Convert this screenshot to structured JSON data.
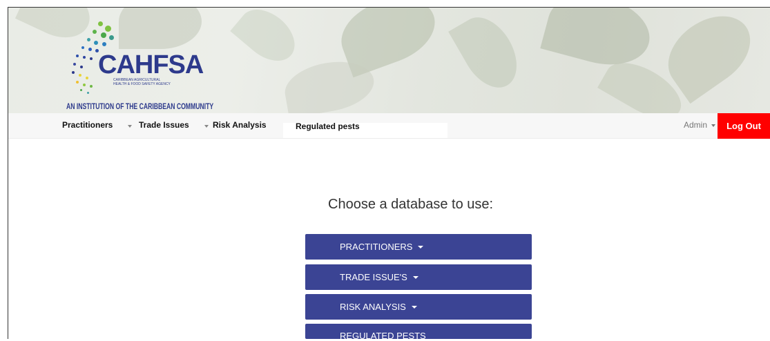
{
  "branding": {
    "logo_text": "CAHFSA",
    "logo_subtitle_1": "CARIBBEAN AGRICULTURAL",
    "logo_subtitle_2": "HEALTH & FOOD SAFETY AGENCY",
    "tagline": "AN INSTITUTION OF THE CARIBBEAN COMMUNITY"
  },
  "navbar": {
    "items": [
      {
        "label": "Practitioners"
      },
      {
        "label": "Trade Issues"
      },
      {
        "label": "Risk Analysis"
      },
      {
        "label": "Regulated pests"
      }
    ],
    "admin_label": "Admin",
    "logout_label": "Log Out"
  },
  "main": {
    "prompt": "Choose a database to use:",
    "buttons": [
      {
        "label": "PRACTITIONERS"
      },
      {
        "label": "TRADE ISSUE'S"
      },
      {
        "label": "RISK ANALYSIS"
      },
      {
        "label": "REGULATED PESTS"
      }
    ]
  },
  "colors": {
    "nav_button": "#3b4494",
    "logout": "#ff0000",
    "brand_blue": "#2d3a8c"
  }
}
